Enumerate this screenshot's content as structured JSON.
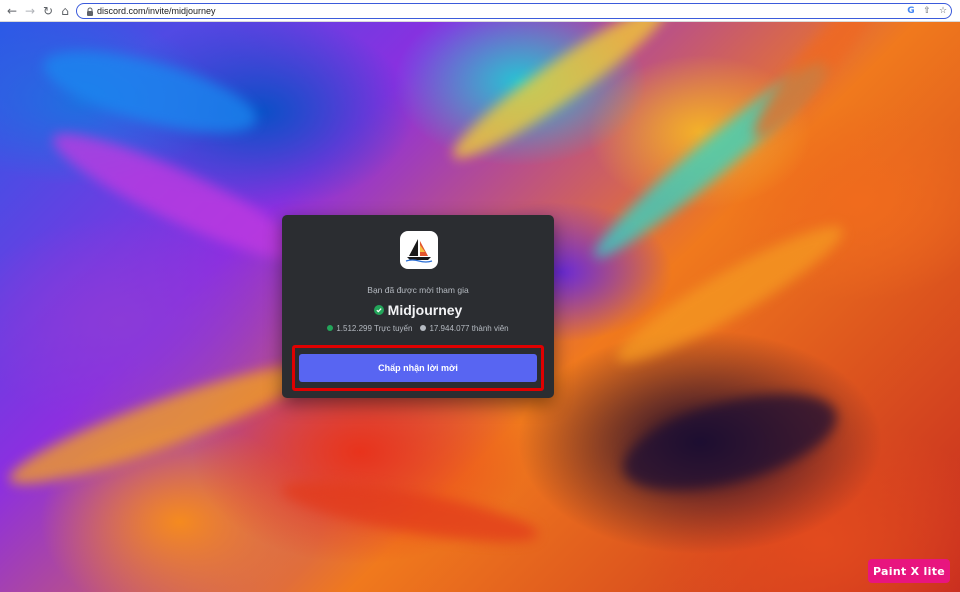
{
  "browser": {
    "url": "discord.com/invite/midjourney",
    "back_icon": "←",
    "forward_icon": "→",
    "reload_icon": "↻",
    "home_icon": "⌂",
    "google_icon": "G",
    "share_icon": "⇧",
    "star_icon": "☆"
  },
  "invite": {
    "invited_text": "Bạn đã được mời tham gia",
    "server_name": "Midjourney",
    "online_count": "1.512.299 Trực tuyến",
    "member_count": "17.944.077 thành viên",
    "accept_label": "Chấp nhận lời mời",
    "colors": {
      "card_bg": "#2b2d31",
      "button": "#5865f2",
      "online_dot": "#23a55a",
      "member_dot": "#b5bac1",
      "verified": "#23a55a",
      "highlight": "#e00000"
    }
  },
  "watermark": {
    "text": "Paint X lite",
    "color": "#e8157f"
  }
}
